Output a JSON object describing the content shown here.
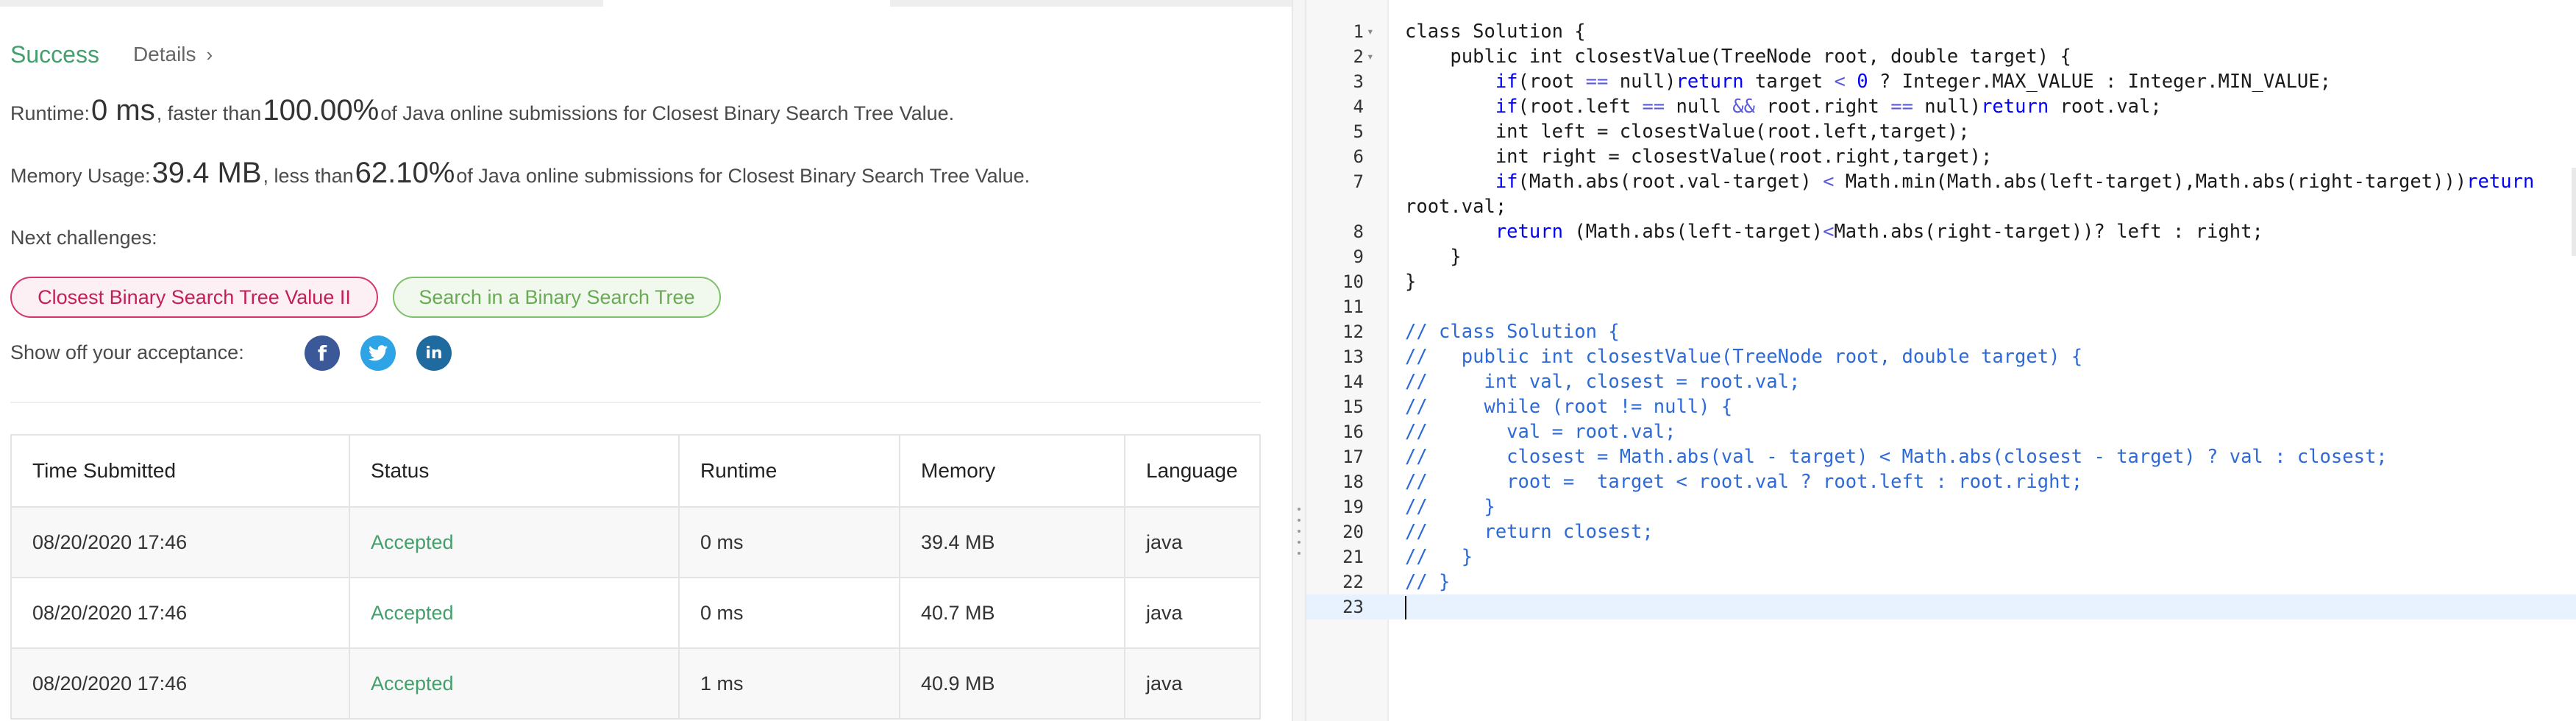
{
  "result": {
    "status": "Success",
    "details_label": "Details",
    "details_chevron": "›",
    "runtime": {
      "prefix": "Runtime: ",
      "value": "0 ms",
      "mid": ", faster than ",
      "percent": "100.00%",
      "suffix": " of Java online submissions for Closest Binary Search Tree Value."
    },
    "memory": {
      "prefix": "Memory Usage: ",
      "value": "39.4 MB",
      "mid": ", less than ",
      "percent": "62.10%",
      "suffix": " of Java online submissions for Closest Binary Search Tree Value."
    },
    "next_challenges_label": "Next challenges:",
    "challenges": [
      {
        "label": "Closest Binary Search Tree Value II",
        "difficulty_color": "#c41e58"
      },
      {
        "label": "Search in a Binary Search Tree",
        "difficulty_color": "#6aaa55"
      }
    ],
    "share_label": "Show off your acceptance:",
    "social_icons": [
      {
        "name": "facebook-icon",
        "glyph": "f",
        "color": "#3b5998"
      },
      {
        "name": "twitter-icon",
        "glyph": "🐦",
        "color": "#2ea3e6"
      },
      {
        "name": "linkedin-icon",
        "glyph": "in",
        "color": "#1f6b9f"
      }
    ]
  },
  "submissions": {
    "columns": [
      "Time Submitted",
      "Status",
      "Runtime",
      "Memory",
      "Language"
    ],
    "rows": [
      [
        "08/20/2020 17:46",
        "Accepted",
        "0 ms",
        "39.4 MB",
        "java"
      ],
      [
        "08/20/2020 17:46",
        "Accepted",
        "0 ms",
        "40.7 MB",
        "java"
      ],
      [
        "08/20/2020 17:46",
        "Accepted",
        "1 ms",
        "40.9 MB",
        "java"
      ]
    ]
  },
  "editor": {
    "lines": [
      {
        "n": "1",
        "fold": true,
        "code": "class Solution {"
      },
      {
        "n": "2",
        "fold": true,
        "code": "    public int closestValue(TreeNode root, double target) {"
      },
      {
        "n": "3",
        "code": "        if(root == null)return target < 0 ? Integer.MAX_VALUE : Integer.MIN_VALUE;"
      },
      {
        "n": "4",
        "code": "        if(root.left == null && root.right == null)return root.val;"
      },
      {
        "n": "5",
        "code": "        int left = closestValue(root.left,target);"
      },
      {
        "n": "6",
        "code": "        int right = closestValue(root.right,target);"
      },
      {
        "n": "7",
        "wrap": true,
        "code": "        if(Math.abs(root.val-target) < Math.min(Math.abs(left-target),Math.abs(right-target)))return root.val;"
      },
      {
        "n": "8",
        "code": "        return (Math.abs(left-target)<Math.abs(right-target))? left : right;"
      },
      {
        "n": "9",
        "code": "    }"
      },
      {
        "n": "10",
        "code": "}"
      },
      {
        "n": "11",
        "code": ""
      },
      {
        "n": "12",
        "comment": true,
        "code": "// class Solution {"
      },
      {
        "n": "13",
        "comment": true,
        "code": "//   public int closestValue(TreeNode root, double target) {"
      },
      {
        "n": "14",
        "comment": true,
        "code": "//     int val, closest = root.val;"
      },
      {
        "n": "15",
        "comment": true,
        "code": "//     while (root != null) {"
      },
      {
        "n": "16",
        "comment": true,
        "code": "//       val = root.val;"
      },
      {
        "n": "17",
        "comment": true,
        "code": "//       closest = Math.abs(val - target) < Math.abs(closest - target) ? val : closest;"
      },
      {
        "n": "18",
        "comment": true,
        "code": "//       root =  target < root.val ? root.left : root.right;"
      },
      {
        "n": "19",
        "comment": true,
        "code": "//     }"
      },
      {
        "n": "20",
        "comment": true,
        "code": "//     return closest;"
      },
      {
        "n": "21",
        "comment": true,
        "code": "//   }"
      },
      {
        "n": "22",
        "comment": true,
        "code": "// }"
      },
      {
        "n": "23",
        "current": true,
        "code": ""
      }
    ]
  }
}
